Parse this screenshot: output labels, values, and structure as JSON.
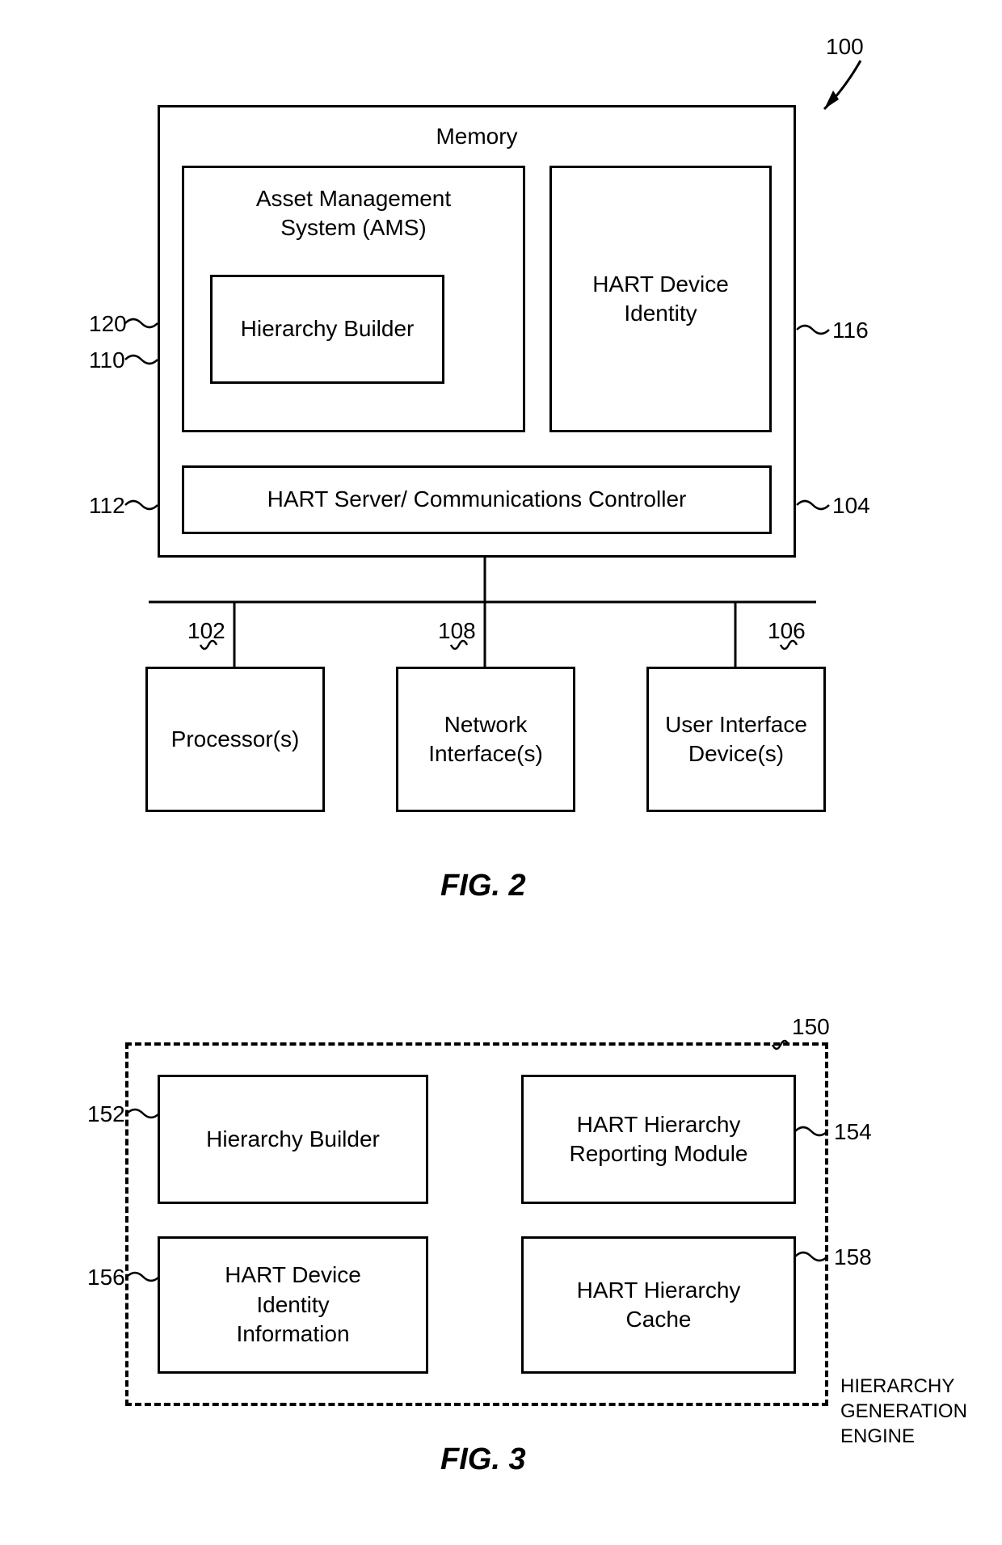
{
  "fig2": {
    "ref100": "100",
    "memory": {
      "title": "Memory",
      "ref": "104"
    },
    "ams": {
      "title": "Asset Management System (AMS)",
      "ref": "110"
    },
    "hierarchy_builder": {
      "label": "Hierarchy Builder",
      "ref": "120"
    },
    "hart_identity": {
      "label": "HART Device Identity",
      "ref": "116"
    },
    "hart_server": {
      "label": "HART Server/ Communications Controller",
      "ref": "112"
    },
    "processor": {
      "label": "Processor(s)",
      "ref": "102"
    },
    "network_if": {
      "label": "Network Interface(s)",
      "ref": "108"
    },
    "user_if": {
      "label": "User Interface Device(s)",
      "ref": "106"
    },
    "caption": "FIG. 2"
  },
  "fig3": {
    "engine": {
      "ref": "150",
      "title": "HIERARCHY GENERATION ENGINE"
    },
    "hierarchy_builder": {
      "label": "Hierarchy Builder",
      "ref": "152"
    },
    "reporting": {
      "label": "HART Hierarchy Reporting Module",
      "ref": "154"
    },
    "identity_info": {
      "label": "HART Device Identity Information",
      "ref": "156"
    },
    "cache": {
      "label": "HART Hierarchy Cache",
      "ref": "158"
    },
    "caption": "FIG. 3"
  }
}
